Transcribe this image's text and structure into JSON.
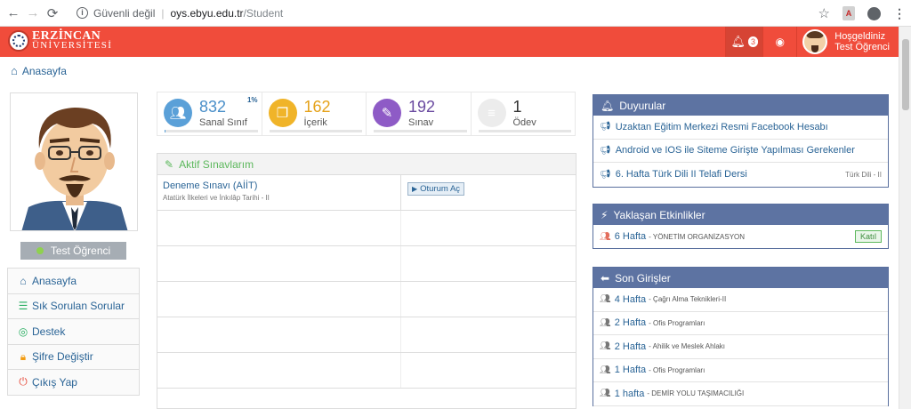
{
  "browser": {
    "security_label": "Güvenli değil",
    "url_host": "oys.ebyu.edu.tr",
    "url_path": "/Student"
  },
  "header": {
    "logo_line1": "ERZİNCAN",
    "logo_line2": "ÜNİVERSİTESİ",
    "notification_count": "3",
    "greeting": "Hoşgeldiniz",
    "user_name": "Test Öğrenci",
    "accent_color": "#f04c3b"
  },
  "breadcrumb": {
    "home": "Anasayfa"
  },
  "profile": {
    "name": "Test Öğrenci"
  },
  "side_menu": [
    {
      "label": "Anasayfa",
      "icon": "home-icon"
    },
    {
      "label": "Sık Sorulan Sorular",
      "icon": "list-icon"
    },
    {
      "label": "Destek",
      "icon": "lifebuoy-icon"
    },
    {
      "label": "Şifre Değiştir",
      "icon": "lock-icon"
    },
    {
      "label": "Çıkış Yap",
      "icon": "power-icon"
    }
  ],
  "stats": [
    {
      "value": "832",
      "label": "Sanal Sınıf",
      "percent": "1%",
      "progress": 0.01,
      "color": "#5aa0d8",
      "num_color": "#4a8fc9",
      "icon": "users-icon"
    },
    {
      "value": "162",
      "label": "İçerik",
      "color": "#f0b429",
      "num_color": "#e5a21a",
      "icon": "file-icon"
    },
    {
      "value": "192",
      "label": "Sınav",
      "color": "#8e5bc6",
      "num_color": "#6a4aa0",
      "icon": "pencil-icon"
    },
    {
      "value": "1",
      "label": "Ödev",
      "color": "#e9e9e9",
      "num_color": "#333333",
      "icon": "stack-icon"
    }
  ],
  "exams": {
    "title": "Aktif Sınavlarım",
    "rows": [
      {
        "name": "Deneme Sınavı (AİİT)",
        "course": "Atatürk İlkeleri ve İnkılâp Tarihi - II",
        "button": "Oturum Aç"
      }
    ]
  },
  "announcements": {
    "title": "Duyurular",
    "items": [
      {
        "text": "Uzaktan Eğitim Merkezi Resmi Facebook Hesabı",
        "tag": ""
      },
      {
        "text": "Android ve IOS ile Siteme Girişte Yapılması Gerekenler",
        "tag": ""
      },
      {
        "text": "6. Hafta Türk Dili II Telafi Dersi",
        "tag": "Türk Dili - II"
      }
    ]
  },
  "events": {
    "title": "Yaklaşan Etkinlikler",
    "items": [
      {
        "title": "6 Hafta",
        "sub": "- YÖNETİM ORGANİZASYON",
        "button": "Katıl"
      }
    ]
  },
  "logins": {
    "title": "Son Girişler",
    "items": [
      {
        "title": "4 Hafta",
        "sub": "- Çağrı Alma Teknikleri-II"
      },
      {
        "title": "2 Hafta",
        "sub": "- Ofis Programları"
      },
      {
        "title": "2 Hafta",
        "sub": "- Ahilik ve Meslek Ahlakı"
      },
      {
        "title": "1 Hafta",
        "sub": "- Ofis Programları"
      },
      {
        "title": "1 hafta",
        "sub": "- DEMİR YOLU TAŞIMACILIĞI"
      }
    ]
  }
}
